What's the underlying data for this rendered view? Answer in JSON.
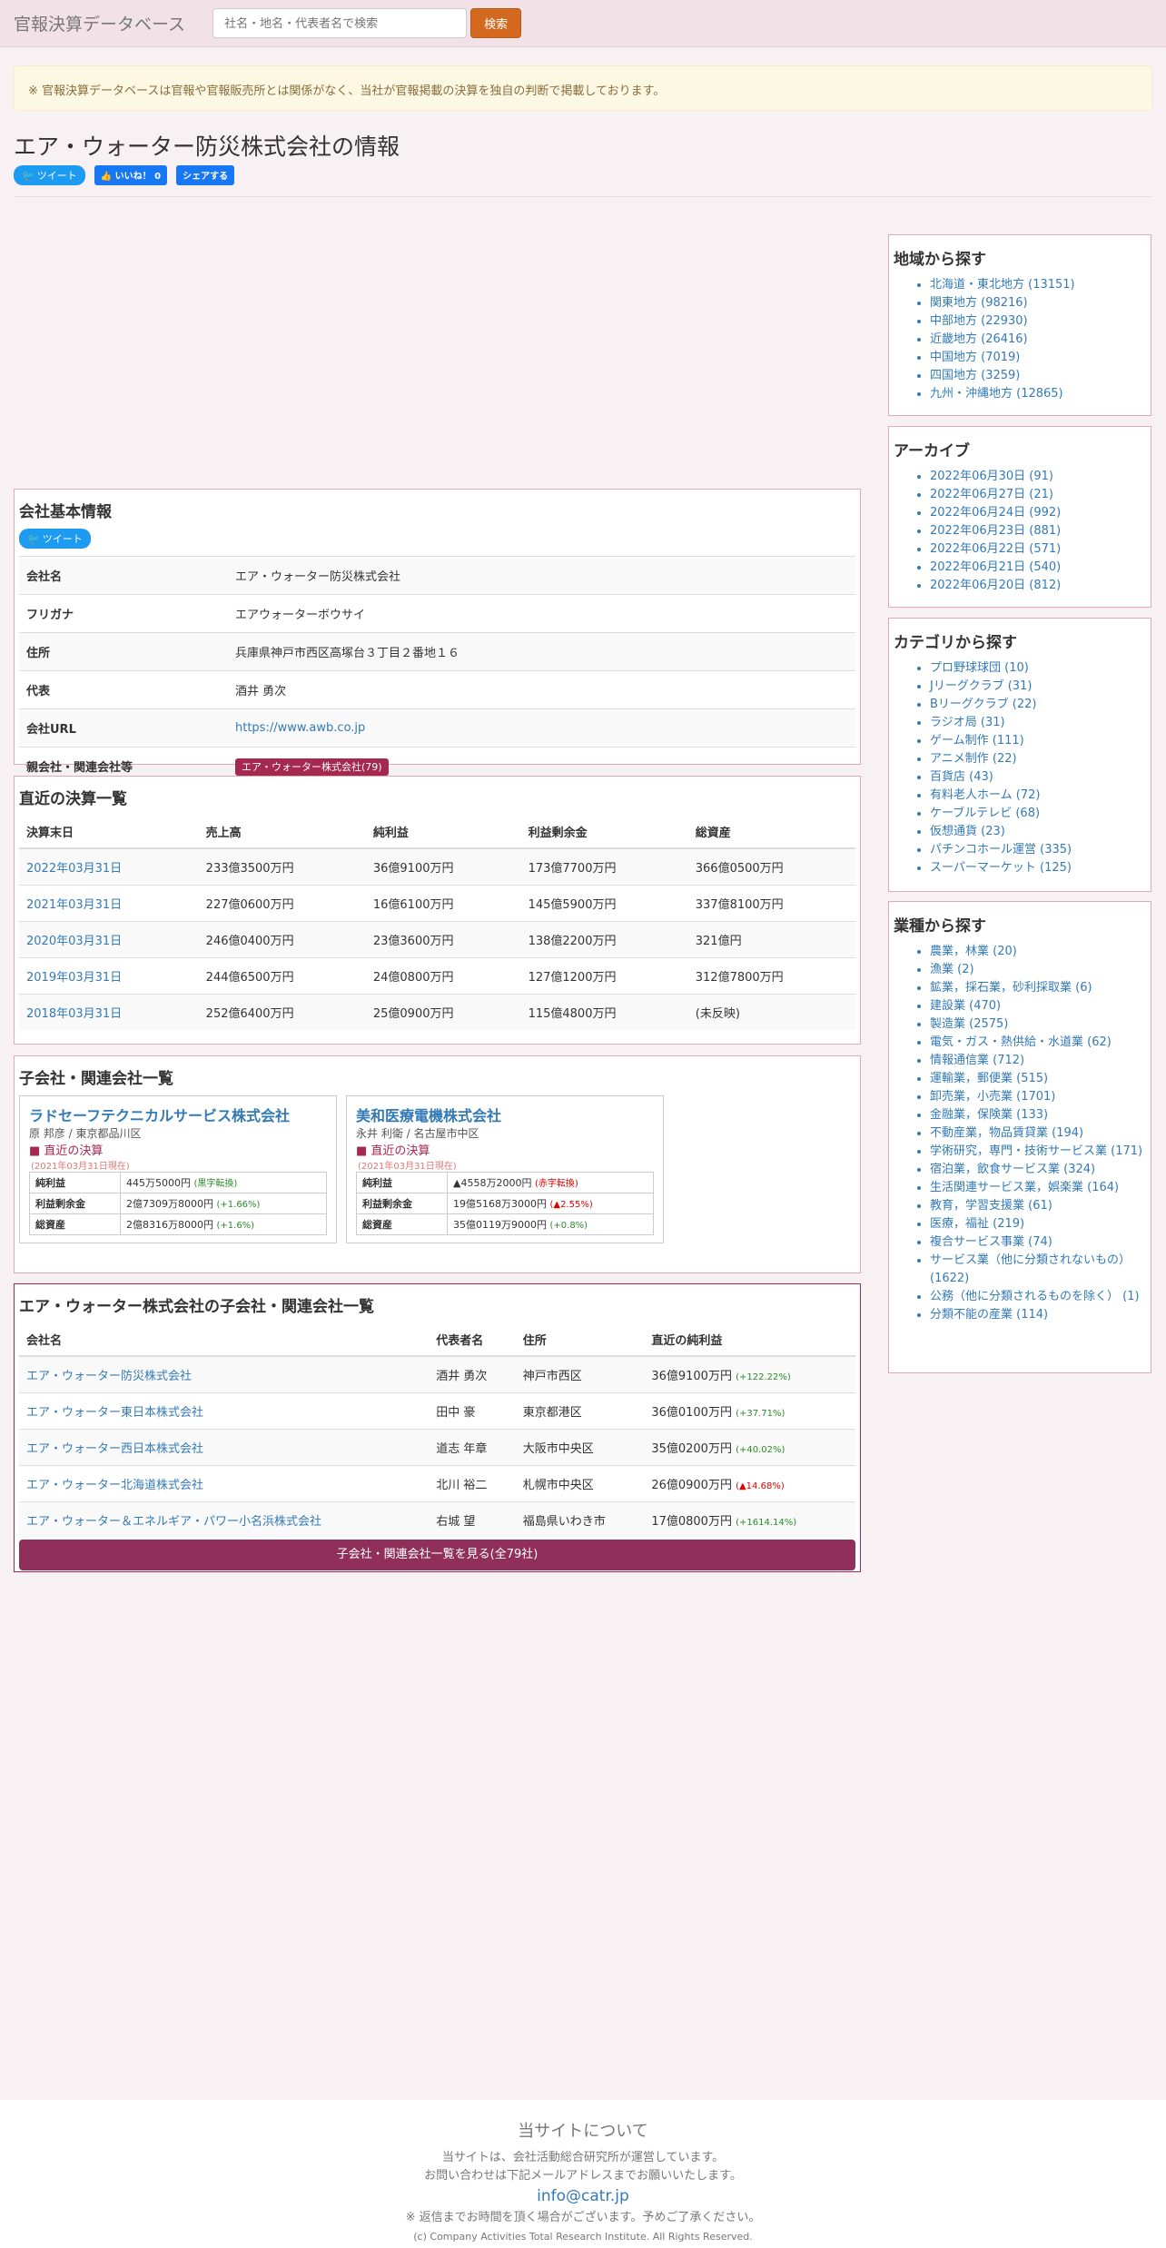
{
  "nav": {
    "brand": "官報決算データベース",
    "search_placeholder": "社名・地名・代表者名で検索",
    "search_button": "検索"
  },
  "notice": "※ 官報決算データベースは官報や官報販売所とは関係がなく、当社が官報掲載の決算を独自の判断で掲載しております。",
  "page_title": "エア・ウォーター防災株式会社の情報",
  "share": {
    "tweet": "ツイート",
    "like": "いいね！ 0",
    "share": "シェアする"
  },
  "basic": {
    "title": "会社基本情報",
    "tweet": "ツイート",
    "rows": [
      {
        "k": "会社名",
        "v": "エア・ウォーター防災株式会社"
      },
      {
        "k": "フリガナ",
        "v": "エアウォーターボウサイ"
      },
      {
        "k": "住所",
        "v": "兵庫県神戸市西区高塚台３丁目２番地１６"
      },
      {
        "k": "代表",
        "v": "酒井 勇次"
      },
      {
        "k": "会社URL",
        "v": "https://www.awb.co.jp"
      },
      {
        "k": "親会社・関連会社等",
        "v": "エア・ウォーター株式会社(79)"
      }
    ]
  },
  "financials": {
    "title": "直近の決算一覧",
    "headers": [
      "決算末日",
      "売上高",
      "純利益",
      "利益剰余金",
      "総資産"
    ],
    "rows": [
      [
        "2022年03月31日",
        "233億3500万円",
        "36億9100万円",
        "173億7700万円",
        "366億0500万円"
      ],
      [
        "2021年03月31日",
        "227億0600万円",
        "16億6100万円",
        "145億5900万円",
        "337億8100万円"
      ],
      [
        "2020年03月31日",
        "246億0400万円",
        "23億3600万円",
        "138億2200万円",
        "321億円"
      ],
      [
        "2019年03月31日",
        "244億6500万円",
        "24億0800万円",
        "127億1200万円",
        "312億7800万円"
      ],
      [
        "2018年03月31日",
        "252億6400万円",
        "25億0900万円",
        "115億4800万円",
        "(未反映)"
      ]
    ]
  },
  "subsidiaries": {
    "title": "子会社・関連会社一覧",
    "cards": [
      {
        "name": "ラドセーフテクニカルサービス株式会社",
        "rep": "原 邦彦 / 東京都品川区",
        "label": "直近の決算",
        "date": "(2021年03月31日現在)",
        "rows": [
          {
            "k": "純利益",
            "v": "445万5000円",
            "d": "(黒字転換)",
            "c": "pos"
          },
          {
            "k": "利益剰余金",
            "v": "2億7309万8000円",
            "d": "(+1.66%)",
            "c": "pos"
          },
          {
            "k": "総資産",
            "v": "2億8316万8000円",
            "d": "(+1.6%)",
            "c": "pos"
          }
        ]
      },
      {
        "name": "美和医療電機株式会社",
        "rep": "永井 利衛 / 名古屋市中区",
        "label": "直近の決算",
        "date": "(2021年03月31日現在)",
        "rows": [
          {
            "k": "純利益",
            "v": "▲4558万2000円",
            "d": "(赤字転換)",
            "c": "neg"
          },
          {
            "k": "利益剰余金",
            "v": "19億5168万3000円",
            "d": "(▲2.55%)",
            "c": "neg"
          },
          {
            "k": "総資産",
            "v": "35億0119万9000円",
            "d": "(+0.8%)",
            "c": "pos"
          }
        ]
      }
    ]
  },
  "parent_group": {
    "title": "エア・ウォーター株式会社の子会社・関連会社一覧",
    "headers": [
      "会社名",
      "代表者名",
      "住所",
      "直近の純利益"
    ],
    "rows": [
      {
        "name": "エア・ウォーター防災株式会社",
        "rep": "酒井 勇次",
        "addr": "神戸市西区",
        "profit": "36億9100万円",
        "chg": "(+122.22%)",
        "c": "pos"
      },
      {
        "name": "エア・ウォーター東日本株式会社",
        "rep": "田中 豪",
        "addr": "東京都港区",
        "profit": "36億0100万円",
        "chg": "(+37.71%)",
        "c": "pos"
      },
      {
        "name": "エア・ウォーター西日本株式会社",
        "rep": "道志 年章",
        "addr": "大阪市中央区",
        "profit": "35億0200万円",
        "chg": "(+40.02%)",
        "c": "pos"
      },
      {
        "name": "エア・ウォーター北海道株式会社",
        "rep": "北川 裕二",
        "addr": "札幌市中央区",
        "profit": "26億0900万円",
        "chg": "(▲14.68%)",
        "c": "neg"
      },
      {
        "name": "エア・ウォーター＆エネルギア・パワー小名浜株式会社",
        "rep": "右城 望",
        "addr": "福島県いわき市",
        "profit": "17億0800万円",
        "chg": "(+1614.14%)",
        "c": "pos"
      }
    ],
    "more_button": "子会社・関連会社一覧を見る(全79社)"
  },
  "sidebar": {
    "region": {
      "title": "地域から探す",
      "items": [
        "北海道・東北地方 (13151)",
        "関東地方 (98216)",
        "中部地方 (22930)",
        "近畿地方 (26416)",
        "中国地方 (7019)",
        "四国地方 (3259)",
        "九州・沖縄地方 (12865)"
      ]
    },
    "archive": {
      "title": "アーカイブ",
      "items": [
        "2022年06月30日 (91)",
        "2022年06月27日 (21)",
        "2022年06月24日 (992)",
        "2022年06月23日 (881)",
        "2022年06月22日 (571)",
        "2022年06月21日 (540)",
        "2022年06月20日 (812)"
      ]
    },
    "category": {
      "title": "カテゴリから探す",
      "items": [
        "プロ野球球団 (10)",
        "Jリーグクラブ (31)",
        "Bリーグクラブ (22)",
        "ラジオ局 (31)",
        "ゲーム制作 (111)",
        "アニメ制作 (22)",
        "百貨店 (43)",
        "有料老人ホーム (72)",
        "ケーブルテレビ (68)",
        "仮想通貨 (23)",
        "パチンコホール運営 (335)",
        "スーパーマーケット (125)"
      ]
    },
    "industry": {
      "title": "業種から探す",
      "items": [
        "農業，林業 (20)",
        "漁業 (2)",
        "鉱業，採石業，砂利採取業 (6)",
        "建設業 (470)",
        "製造業 (2575)",
        "電気・ガス・熱供給・水道業 (62)",
        "情報通信業 (712)",
        "運輸業，郵便業 (515)",
        "卸売業，小売業 (1701)",
        "金融業，保険業 (133)",
        "不動産業，物品賃貸業 (194)",
        "学術研究，専門・技術サービス業 (171)",
        "宿泊業，飲食サービス業 (324)",
        "生活関連サービス業，娯楽業 (164)",
        "教育，学習支援業 (61)",
        "医療，福祉 (219)",
        "複合サービス事業 (74)",
        "サービス業（他に分類されないもの） (1622)",
        "公務（他に分類されるものを除く） (1)",
        "分類不能の産業 (114)"
      ]
    }
  },
  "footer": {
    "title": "当サイトについて",
    "line1": "当サイトは、会社活動総合研究所が運営しています。",
    "line2": "お問い合わせは下記メールアドレスまでお願いいたします。",
    "email": "info@catr.jp",
    "note": "※ 返信までお時間を頂く場合がございます。予めご了承ください。",
    "copyright": "(c) Company Activities Total Research Institute. All Rights Reserved."
  }
}
